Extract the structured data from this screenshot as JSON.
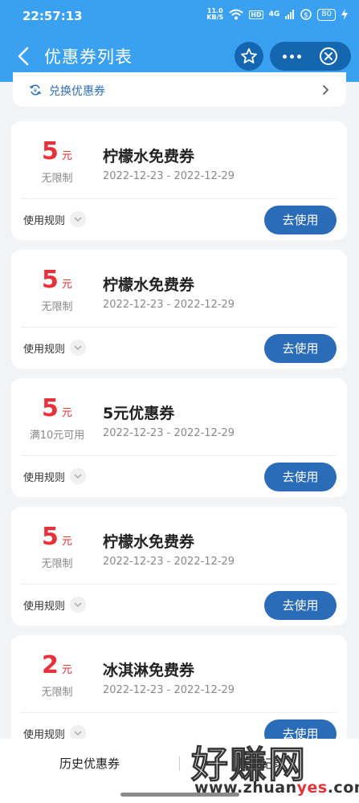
{
  "statusbar": {
    "time": "22:57:13",
    "net_speed_top": "11.0",
    "net_speed_bottom": "KB/S",
    "hd": "HD",
    "signal": "4G",
    "battery": "80"
  },
  "navbar": {
    "title": "优惠券列表",
    "icons": [
      "back-icon",
      "star-icon",
      "more-icon",
      "close-icon"
    ]
  },
  "exchange": {
    "label": "兑换优惠券"
  },
  "coupons": [
    {
      "amount": "5",
      "unit": "元",
      "condition": "无限制",
      "name": "柠檬水免费券",
      "date": "2022-12-23 - 2022-12-29",
      "rules": "使用规则",
      "button": "去使用"
    },
    {
      "amount": "5",
      "unit": "元",
      "condition": "无限制",
      "name": "柠檬水免费券",
      "date": "2022-12-23 - 2022-12-29",
      "rules": "使用规则",
      "button": "去使用"
    },
    {
      "amount": "5",
      "unit": "元",
      "condition": "满10元可用",
      "name": "5元优惠券",
      "date": "2022-12-23 - 2022-12-29",
      "rules": "使用规则",
      "button": "去使用"
    },
    {
      "amount": "5",
      "unit": "元",
      "condition": "无限制",
      "name": "柠檬水免费券",
      "date": "2022-12-23 - 2022-12-29",
      "rules": "使用规则",
      "button": "去使用"
    },
    {
      "amount": "2",
      "unit": "元",
      "condition": "无限制",
      "name": "冰淇淋免费券",
      "date": "2022-12-23 - 2022-12-29",
      "rules": "使用规则",
      "button": "去使用"
    }
  ],
  "bottombar": {
    "history": "历史优惠券",
    "other": "其他记录"
  },
  "watermark": {
    "big": "好赚网",
    "small_a": "www.zhuan",
    "small_b": "yes",
    "small_c": ".com"
  },
  "colors": {
    "header": "#3aa0f0",
    "amount": "#e5323a",
    "button": "#2b6cb8"
  }
}
